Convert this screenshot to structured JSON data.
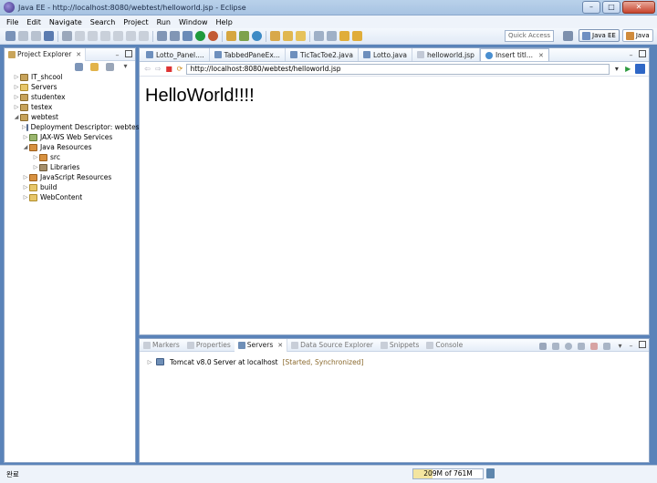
{
  "window": {
    "title": "Java EE - http://localhost:8080/webtest/helloworld.jsp - Eclipse",
    "minimize": "–",
    "maximize": "□",
    "close": "✕"
  },
  "menu": [
    "File",
    "Edit",
    "Navigate",
    "Search",
    "Project",
    "Run",
    "Window",
    "Help"
  ],
  "toolbar": {
    "quick_access_placeholder": "Quick Access",
    "perspectives": [
      {
        "label": "Java EE",
        "active": true
      },
      {
        "label": "Java",
        "active": false
      }
    ]
  },
  "project_explorer": {
    "title": "Project Explorer",
    "close": "✕",
    "tree": [
      {
        "label": "IT_shcool",
        "depth": 0,
        "expander": "▷",
        "icon": "project"
      },
      {
        "label": "Servers",
        "depth": 0,
        "expander": "▷",
        "icon": "folder"
      },
      {
        "label": "studentex",
        "depth": 0,
        "expander": "▷",
        "icon": "project"
      },
      {
        "label": "testex",
        "depth": 0,
        "expander": "▷",
        "icon": "project"
      },
      {
        "label": "webtest",
        "depth": 0,
        "expander": "◢",
        "icon": "project"
      },
      {
        "label": "Deployment Descriptor: webtes",
        "depth": 1,
        "expander": "▷",
        "icon": "desc"
      },
      {
        "label": "JAX-WS Web Services",
        "depth": 1,
        "expander": "▷",
        "icon": "ws"
      },
      {
        "label": "Java Resources",
        "depth": 1,
        "expander": "◢",
        "icon": "pkg"
      },
      {
        "label": "src",
        "depth": 2,
        "expander": "▷",
        "icon": "pkg"
      },
      {
        "label": "Libraries",
        "depth": 2,
        "expander": "▷",
        "icon": "lib"
      },
      {
        "label": "JavaScript Resources",
        "depth": 1,
        "expander": "▷",
        "icon": "pkg"
      },
      {
        "label": "build",
        "depth": 1,
        "expander": "▷",
        "icon": "folder"
      },
      {
        "label": "WebContent",
        "depth": 1,
        "expander": "▷",
        "icon": "folder"
      }
    ]
  },
  "editor": {
    "tabs": [
      {
        "label": "Lotto_Panel....",
        "icon": "j",
        "active": false
      },
      {
        "label": "TabbedPaneEx...",
        "icon": "j",
        "active": false
      },
      {
        "label": "TicTacToe2.java",
        "icon": "j",
        "active": false
      },
      {
        "label": "Lotto.java",
        "icon": "j",
        "active": false
      },
      {
        "label": "helloworld.jsp",
        "icon": "f",
        "active": false
      },
      {
        "label": "Insert titl...",
        "icon": "w",
        "active": true
      }
    ],
    "tab_close": "✕",
    "browser": {
      "back": "⇦",
      "forward": "⇨",
      "stop": "■",
      "refresh": "⟳",
      "go": "▶",
      "url": "http://localhost:8080/webtest/helloworld.jsp",
      "dropdown": "▾"
    },
    "page_heading": "HelloWorld!!!!"
  },
  "bottom_panel": {
    "tabs": [
      {
        "label": "Markers",
        "active": false
      },
      {
        "label": "Properties",
        "active": false
      },
      {
        "label": "Servers",
        "active": true
      },
      {
        "label": "Data Source Explorer",
        "active": false
      },
      {
        "label": "Snippets",
        "active": false
      },
      {
        "label": "Console",
        "active": false
      }
    ],
    "close": "✕",
    "servers": [
      {
        "name": "Tomcat v8.0 Server at localhost",
        "status": "[Started, Synchronized]",
        "expander": "▷"
      }
    ]
  },
  "statusbar": {
    "text": "완료",
    "heap": "209M of 761M",
    "heap_fraction": 0.2746
  },
  "colors": {
    "window_frame": "#5a83b9",
    "title_gradient": "#b9d1ea",
    "accent_blue": "#2f67c6"
  }
}
